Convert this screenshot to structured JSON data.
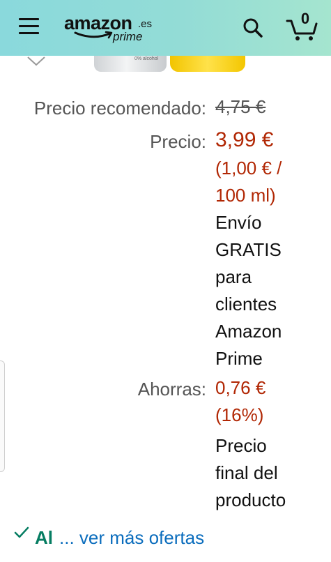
{
  "header": {
    "logo_word": "amazon",
    "logo_tld": ".es",
    "logo_sub": "prime",
    "cart_count": "0"
  },
  "product_image": {
    "bottle_text": "0% alcohol"
  },
  "pricing": {
    "list_price_label": "Precio recomendado:",
    "list_price": "4,75 €",
    "price_label": "Precio:",
    "price": "3,99 €",
    "unit_price_line1": "(1,00 € /",
    "unit_price_line2": "100 ml)",
    "shipping_lines": [
      "Envío",
      "GRATIS",
      "para",
      "clientes",
      "Amazon",
      "Prime"
    ],
    "savings_label": "Ahorras:",
    "savings_amount": "0,76 €",
    "savings_percent": "(16%)",
    "final_lines": [
      "Precio",
      "final del",
      "producto"
    ]
  },
  "offers": {
    "availability": "Al",
    "more_link": "... ver más ofertas"
  },
  "colors": {
    "header_gradient_start": "#8ad9dc",
    "header_gradient_end": "#a5e5cf",
    "price_red": "#b12704",
    "link_blue": "#0b6dbd",
    "stock_green": "#067d62"
  }
}
